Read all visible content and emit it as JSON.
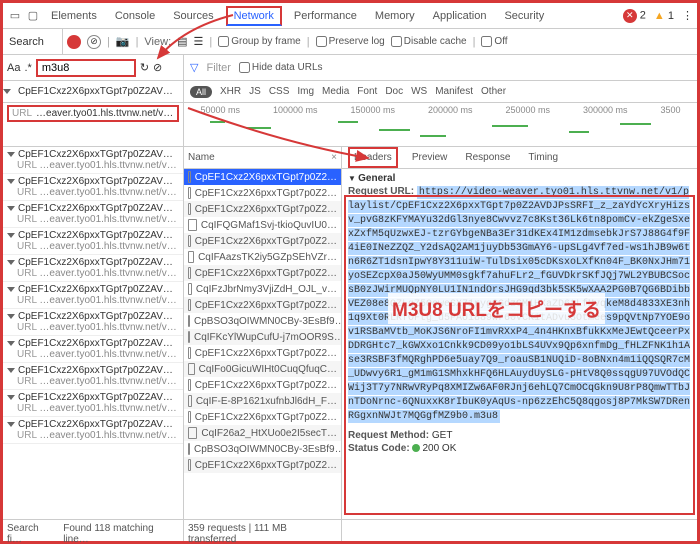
{
  "devtools_tabs": [
    "Elements",
    "Console",
    "Sources",
    "Network",
    "Performance",
    "Memory",
    "Application",
    "Security"
  ],
  "active_tab": "Network",
  "errors": "2",
  "warnings": "1",
  "search": {
    "label": "Search",
    "value": "m3u8",
    "aa": "Aa",
    "regex": ".*"
  },
  "view_label": "View:",
  "options": {
    "group": "Group by frame",
    "preserve": "Preserve log",
    "disable": "Disable cache",
    "offline": "Off",
    "hide": "Hide data URLs"
  },
  "filter_placeholder": "Filter",
  "filter_types": [
    "All",
    "XHR",
    "JS",
    "CSS",
    "Img",
    "Media",
    "Font",
    "Doc",
    "WS",
    "Manifest",
    "Other"
  ],
  "waterfall_ticks": [
    "50000 ms",
    "100000 ms",
    "150000 ms",
    "200000 ms",
    "250000 ms",
    "300000 ms",
    "3500"
  ],
  "first_result": {
    "title": "CpEF1Cxz2X6pxxTGpt7p0Z2AVDJP…",
    "url": "…eaver.tyo01.hls.ttvnw.net/v…"
  },
  "left_results": [
    "CpEF1Cxz2X6pxxTGpt7p0Z2AVDJP…",
    "CpEF1Cxz2X6pxxTGpt7p0Z2AVDJP…",
    "CpEF1Cxz2X6pxxTGpt7p0Z2AVDJP…",
    "CpEF1Cxz2X6pxxTGpt7p0Z2AVDJP…",
    "CpEF1Cxz2X6pxxTGpt7p0Z2AVDJP…",
    "CpEF1Cxz2X6pxxTGpt7p0Z2AVDJP…",
    "CpEF1Cxz2X6pxxTGpt7p0Z2AVDJP…",
    "CpEF1Cxz2X6pxxTGpt7p0Z2AVDJP…",
    "CpEF1Cxz2X6pxxTGpt7p0Z2AVDJP…",
    "CpEF1Cxz2X6pxxTGpt7p0Z2AVDJP…",
    "CpEF1Cxz2X6pxxTGpt7p0Z2AVDJP…"
  ],
  "left_url": "…eaver.tyo01.hls.ttvnw.net/v…",
  "mid_header": "Name",
  "requests": [
    "CpEF1Cxz2X6pxxTGpt7p0Z2…",
    "CpEF1Cxz2X6pxxTGpt7p0Z2…",
    "CpEF1Cxz2X6pxxTGpt7p0Z2…",
    "CqIFQGMaf1Svj-tkioQuvIU0…",
    "CpEF1Cxz2X6pxxTGpt7p0Z2…",
    "CqIFAazsTK2iy5GZpSEhVZr…",
    "CpEF1Cxz2X6pxxTGpt7p0Z2…",
    "CqIFzJbrNmy3VjiZdH_OJL_v…",
    "CpEF1Cxz2X6pxxTGpt7p0Z2…",
    "CpBSO3qOIWMN0CBy-3EsBf9…",
    "CqIFKcYlWupCufU-j7mOOR9S…",
    "CpEF1Cxz2X6pxxTGpt7p0Z2…",
    "CqIFo0GicuWIHt0CuqQfuqC…",
    "CpEF1Cxz2X6pxxTGpt7p0Z2…",
    "CqIF-E-8P1621xufnbJl6dH_F…",
    "CpEF1Cxz2X6pxxTGpt7p0Z2…",
    "CqIF26a2_HtXUo0e2I5secT…",
    "CpBSO3qOIWMN0CBy-3EsBf9…",
    "CpEF1Cxz2X6pxxTGpt7p0Z2…"
  ],
  "detail_tabs": [
    "Headers",
    "Preview",
    "Response",
    "Timing"
  ],
  "general_label": "General",
  "req_url_label": "Request URL:",
  "req_url": "https://video-weaver.tyo01.hls.ttvnw.net/v1/playlist/CpEF1Cxz2X6pxxTGpt7p0Z2AVDJPsSRFI_z_zaYdYcXryHizsv_pvG8zKFYMAYu32dGl3nye8Cwvvz7c8Kst36Lk6tn8pomCv-ekZgeSxexZxfM5qUzwxEJ-tzrGYbgeNBa3Er31dKEx4IM1zdmsebkJrS7J88G4f9F4iE0INeZZQZ_Y2dsAQ2AM1juyDb53GmAY6-upSLg4Vf7ed-ws1hJB9w6tn6R6ZT1dsnIpwY8Y311uiW-TulDsix05cDKsxoLXfKn04F_BK0NxJHm71yoSEZcpX0aJ50WyUMM0sgkf7ahuFLr2_fGUVDkrSKfJQj7WL2YBUBCSocsB0zJWirMUQpNY0LU1IN1ndOrsJHG9qd3bk5SK5wXAA2PG0B7QG6BDibbVEZ08e8QZLqZ5QeweSX71rygGGdzGM1HXaZD6tLfMvqkeM8d4833XE3nh1q9Xt0RLRfOFtg_d5PAUi889wr60vCK1tADvu3Otmees9pQVtNp7YOE9ov1RSBaMVtb_MoKJS6NroFI1mvRXxP4_4n4HKnxBfukKxMeJEwtQceerPxDDRGHtc7_kGWXxo1Cnkk9CD09yo1bLS4UVx9Qp6xnfmDg_fHLZFNK1h1Ase3RSBF3fMQRghPD6e5uay7Q9_roauSB1NUQiD-8oBNxn4m1iQQSQR7cM_UDwvy6R1_gM1mG1SMhxkHFQ6HLAuydUySLG-pHtV8Q0ssqgU97UVOdQCWij3T7y7NRwVRyPq8XMIZw6AF0RJnj6ehLQ7CmOCqGkn9U8rP8QmwTTbJnTDoNrnc-6QNuxxK8rIbuK0yAqUs-np6zzEhC5Q8qgosj8P7MkSW7DRenRGgxnNWJt7MQGgfMZ9b0.m3u8",
  "req_method_label": "Request Method:",
  "req_method": "GET",
  "status_code_label": "Status Code:",
  "status_code": "200 OK",
  "overlay": "M3U8 URLをコピーする",
  "status": {
    "searchfi": "Search fi…",
    "found": "Found 118 matching line…",
    "requests": "359 requests",
    "transfer": "111 MB transferred"
  }
}
